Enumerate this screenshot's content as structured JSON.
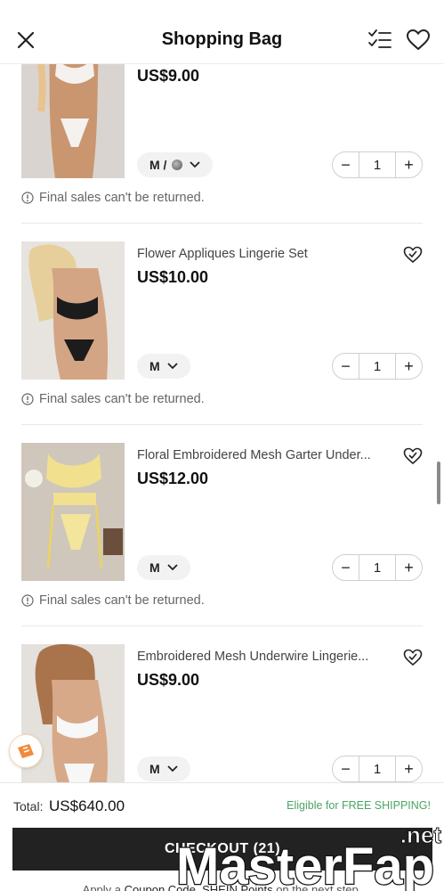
{
  "header": {
    "title": "Shopping Bag"
  },
  "items": [
    {
      "name": "",
      "price": "US$9.00",
      "variant": "M /",
      "has_swatch": true,
      "quantity": "1",
      "note": "Final sales can't be returned."
    },
    {
      "name": "Flower Appliques Lingerie Set",
      "price": "US$10.00",
      "variant": "M",
      "has_swatch": false,
      "quantity": "1",
      "note": "Final sales can't be returned."
    },
    {
      "name": "Floral Embroidered Mesh Garter Under...",
      "price": "US$12.00",
      "variant": "M",
      "has_swatch": false,
      "quantity": "1",
      "note": "Final sales can't be returned."
    },
    {
      "name": "Embroidered Mesh Underwire Lingerie...",
      "price": "US$9.00",
      "variant": "M",
      "has_swatch": false,
      "quantity": "1",
      "note": ""
    }
  ],
  "qty_minus": "−",
  "qty_plus": "+",
  "footer": {
    "total_label": "Total:",
    "total_value": "US$640.00",
    "shipping": "Eligible for FREE SHIPPING!",
    "checkout": "CHECKOUT (21)",
    "coupon_hint": {
      "prefix": "Apply a ",
      "link1": "Coupon Code",
      "mid": ", ",
      "link2": "SHEIN Points",
      "suffix": " on the next step."
    }
  },
  "watermark": {
    "text": "MasterFap",
    "suffix": ".net"
  },
  "colors": {
    "accent_green": "#4aa564",
    "checkout_bg": "#222222",
    "watermark_blue": "#18a3d8"
  },
  "icons": [
    "close-icon",
    "checklist-icon",
    "heart-icon",
    "wishlist-add-icon",
    "chevron-down-icon",
    "info-icon",
    "coupon-icon"
  ]
}
